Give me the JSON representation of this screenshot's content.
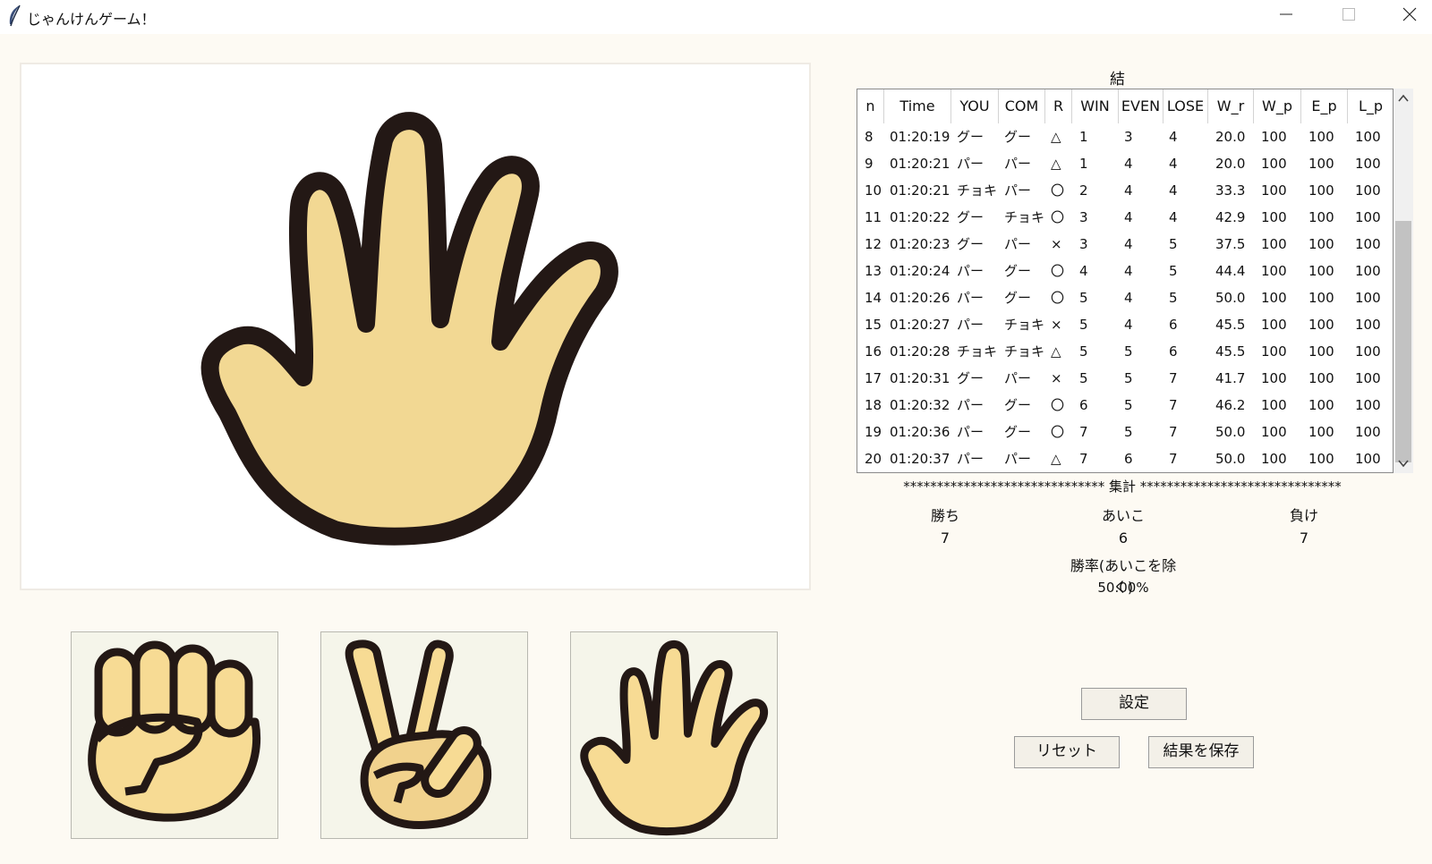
{
  "window": {
    "title": "じゃんけんゲーム！",
    "icon": "feather-icon",
    "controls": [
      "minimize-icon",
      "maximize-icon",
      "close-icon"
    ]
  },
  "main_hand": {
    "icon": "paper-hand-icon",
    "skin_color": "#f2d893",
    "outline_color": "#231815"
  },
  "choices": [
    {
      "icon": "rock-hand-icon",
      "label": "グー"
    },
    {
      "icon": "scissors-hand-icon",
      "label": "チョキ"
    },
    {
      "icon": "paper-hand-icon",
      "label": "パー"
    }
  ],
  "results": {
    "title": "結果",
    "columns": [
      "n",
      "Time",
      "YOU",
      "COM",
      "R",
      "WIN",
      "EVEN",
      "LOSE",
      "W_r",
      "W_p",
      "E_p",
      "L_p"
    ],
    "rows": [
      [
        "8",
        "01:20:19",
        "グー",
        "グー",
        "△",
        "1",
        "3",
        "4",
        "20.0",
        "100",
        "100",
        "100"
      ],
      [
        "9",
        "01:20:21",
        "パー",
        "パー",
        "△",
        "1",
        "4",
        "4",
        "20.0",
        "100",
        "100",
        "100"
      ],
      [
        "10",
        "01:20:21",
        "チョキ",
        "パー",
        "〇",
        "2",
        "4",
        "4",
        "33.3",
        "100",
        "100",
        "100"
      ],
      [
        "11",
        "01:20:22",
        "グー",
        "チョキ",
        "〇",
        "3",
        "4",
        "4",
        "42.9",
        "100",
        "100",
        "100"
      ],
      [
        "12",
        "01:20:23",
        "グー",
        "パー",
        "×",
        "3",
        "4",
        "5",
        "37.5",
        "100",
        "100",
        "100"
      ],
      [
        "13",
        "01:20:24",
        "パー",
        "グー",
        "〇",
        "4",
        "4",
        "5",
        "44.4",
        "100",
        "100",
        "100"
      ],
      [
        "14",
        "01:20:26",
        "パー",
        "グー",
        "〇",
        "5",
        "4",
        "5",
        "50.0",
        "100",
        "100",
        "100"
      ],
      [
        "15",
        "01:20:27",
        "パー",
        "チョキ",
        "×",
        "5",
        "4",
        "6",
        "45.5",
        "100",
        "100",
        "100"
      ],
      [
        "16",
        "01:20:28",
        "チョキ",
        "チョキ",
        "△",
        "5",
        "5",
        "6",
        "45.5",
        "100",
        "100",
        "100"
      ],
      [
        "17",
        "01:20:31",
        "グー",
        "パー",
        "×",
        "5",
        "5",
        "7",
        "41.7",
        "100",
        "100",
        "100"
      ],
      [
        "18",
        "01:20:32",
        "パー",
        "グー",
        "〇",
        "6",
        "5",
        "7",
        "46.2",
        "100",
        "100",
        "100"
      ],
      [
        "19",
        "01:20:36",
        "パー",
        "グー",
        "〇",
        "7",
        "5",
        "7",
        "50.0",
        "100",
        "100",
        "100"
      ],
      [
        "20",
        "01:20:37",
        "パー",
        "パー",
        "△",
        "7",
        "6",
        "7",
        "50.0",
        "100",
        "100",
        "100"
      ]
    ]
  },
  "summary": {
    "header": "****************************** 集計 ******************************",
    "win_label": "勝ち",
    "win_value": "7",
    "even_label": "あいこ",
    "even_value": "6",
    "lose_label": "負け",
    "lose_value": "7",
    "rate_label": "勝率(あいこを除く)",
    "rate_value": "50.00%"
  },
  "buttons": {
    "settings": "設定",
    "reset": "リセット",
    "save": "結果を保存"
  }
}
